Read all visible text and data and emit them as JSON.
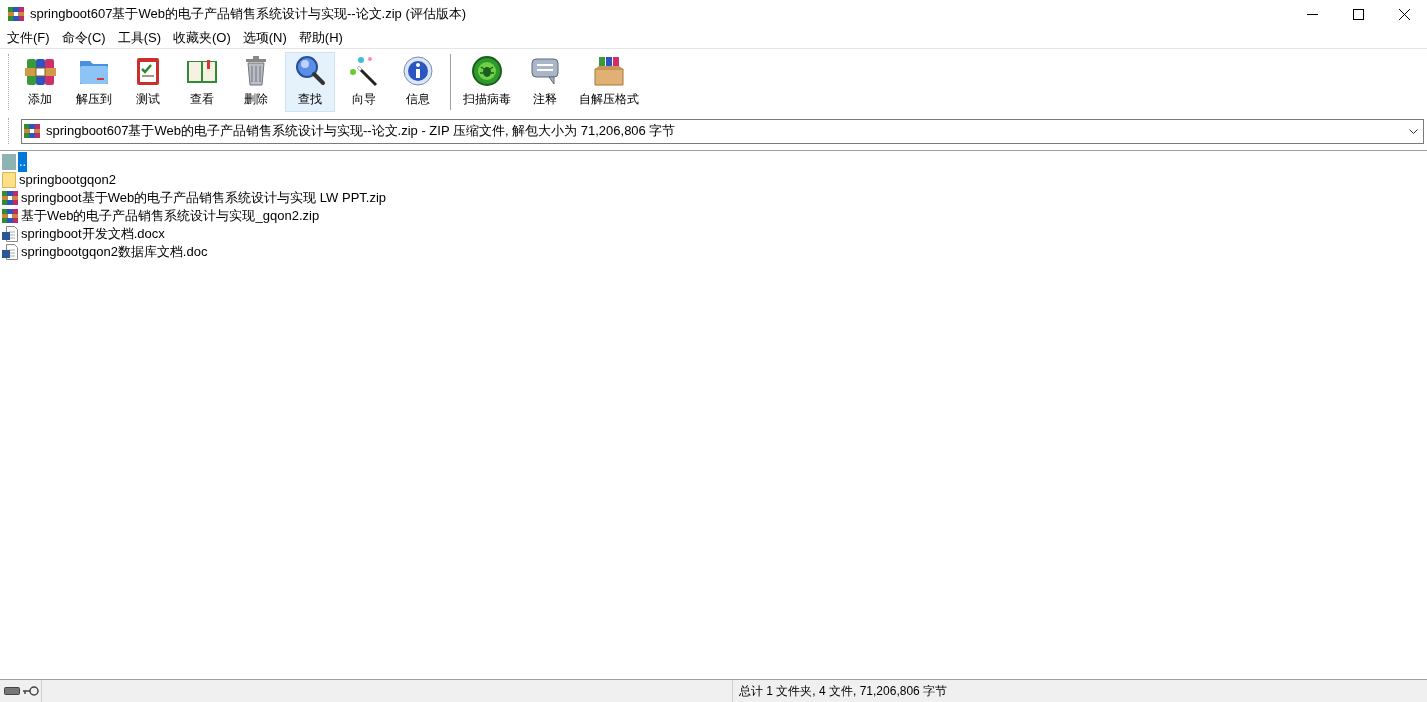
{
  "window": {
    "title": "springboot607基于Web的电子产品销售系统设计与实现--论文.zip (评估版本)"
  },
  "menu": [
    "文件(F)",
    "命令(C)",
    "工具(S)",
    "收藏夹(O)",
    "选项(N)",
    "帮助(H)"
  ],
  "toolbar": [
    {
      "label": "添加",
      "kind": "add",
      "selected": false,
      "separator_before": false
    },
    {
      "label": "解压到",
      "kind": "extract",
      "selected": false,
      "separator_before": false
    },
    {
      "label": "测试",
      "kind": "test",
      "selected": false,
      "separator_before": false
    },
    {
      "label": "查看",
      "kind": "view",
      "selected": false,
      "separator_before": false
    },
    {
      "label": "删除",
      "kind": "delete",
      "selected": false,
      "separator_before": false
    },
    {
      "label": "查找",
      "kind": "find",
      "selected": true,
      "separator_before": false
    },
    {
      "label": "向导",
      "kind": "wizard",
      "selected": false,
      "separator_before": false
    },
    {
      "label": "信息",
      "kind": "info",
      "selected": false,
      "separator_before": false
    },
    {
      "label": "扫描病毒",
      "kind": "virus",
      "selected": false,
      "separator_before": true
    },
    {
      "label": "注释",
      "kind": "comment",
      "selected": false,
      "separator_before": false
    },
    {
      "label": "自解压格式",
      "kind": "sfx",
      "selected": false,
      "separator_before": false
    }
  ],
  "address": {
    "value": "springboot607基于Web的电子产品销售系统设计与实现--论文.zip - ZIP 压缩文件, 解包大小为 71,206,806 字节"
  },
  "files": [
    {
      "name": "..",
      "kind": "up",
      "selected": true
    },
    {
      "name": "springbootgqon2",
      "kind": "folder",
      "selected": false
    },
    {
      "name": "springboot基于Web的电子产品销售系统设计与实现 LW PPT.zip",
      "kind": "archive",
      "selected": false
    },
    {
      "name": "基于Web的电子产品销售系统设计与实现_gqon2.zip",
      "kind": "archive",
      "selected": false
    },
    {
      "name": "springboot开发文档.docx",
      "kind": "word",
      "selected": false
    },
    {
      "name": "springbootgqon2数据库文档.doc",
      "kind": "word",
      "selected": false
    }
  ],
  "status_bar": {
    "summary": "总计 1 文件夹, 4 文件, 71,206,806 字节"
  }
}
